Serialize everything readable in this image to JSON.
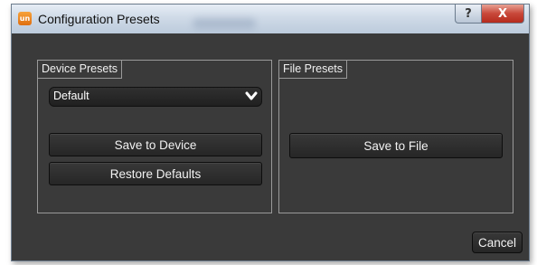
{
  "window": {
    "title": "Configuration Presets",
    "app_icon_text": "un",
    "help_label": "?",
    "close_label": "X"
  },
  "device_presets": {
    "group_label": "Device Presets",
    "selected_preset": "Default",
    "save_label": "Save to Device",
    "restore_label": "Restore Defaults"
  },
  "file_presets": {
    "group_label": "File Presets",
    "save_label": "Save to File"
  },
  "footer": {
    "cancel_label": "Cancel"
  },
  "colors": {
    "background": "#3a3a3a",
    "button": "#2f2f2f",
    "text": "#f2f2f2",
    "close_button": "#c8483a",
    "app_icon": "#e8821e"
  }
}
